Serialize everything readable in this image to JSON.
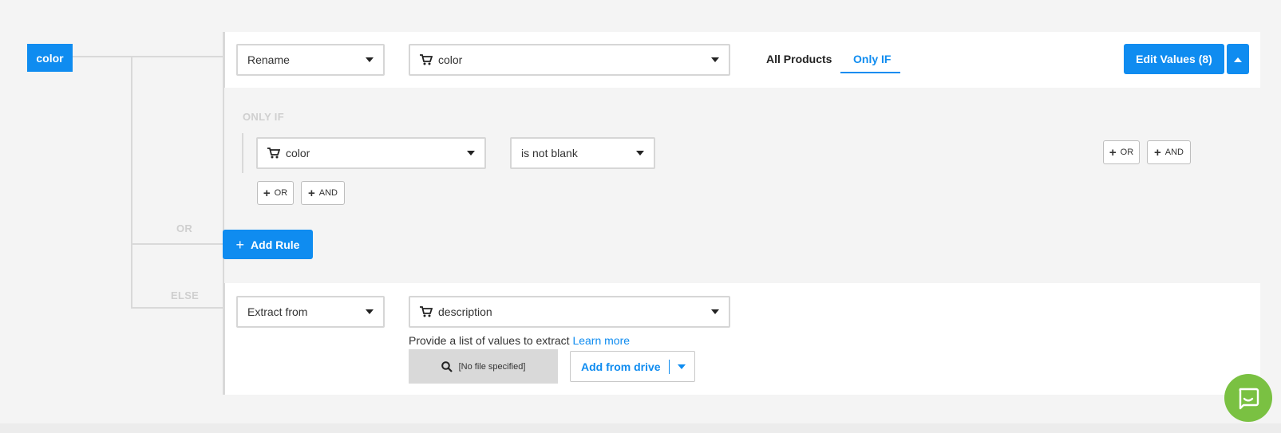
{
  "source": {
    "label": "color"
  },
  "rule": {
    "action_select": "Rename",
    "field_select": "color",
    "tabs": [
      {
        "label": "All Products"
      },
      {
        "label": "Only IF"
      }
    ],
    "active_tab": "Only IF",
    "edit_values_label": "Edit Values (8)"
  },
  "only_if": {
    "heading": "ONLY IF",
    "condition": {
      "field": "color",
      "operator": "is not blank"
    },
    "or_label": "OR",
    "and_label": "AND"
  },
  "connectors": {
    "or_label": "OR",
    "else_label": "ELSE"
  },
  "add_rule_label": "Add Rule",
  "else_rule": {
    "action_select": "Extract from",
    "field_select": "description",
    "help_text": "Provide a list of values to extract",
    "learn_more": "Learn more",
    "file_placeholder": "[No file specified]",
    "drive_label": "Add from drive"
  },
  "colors": {
    "accent": "#0f8cf0",
    "chat": "#7ac142"
  }
}
